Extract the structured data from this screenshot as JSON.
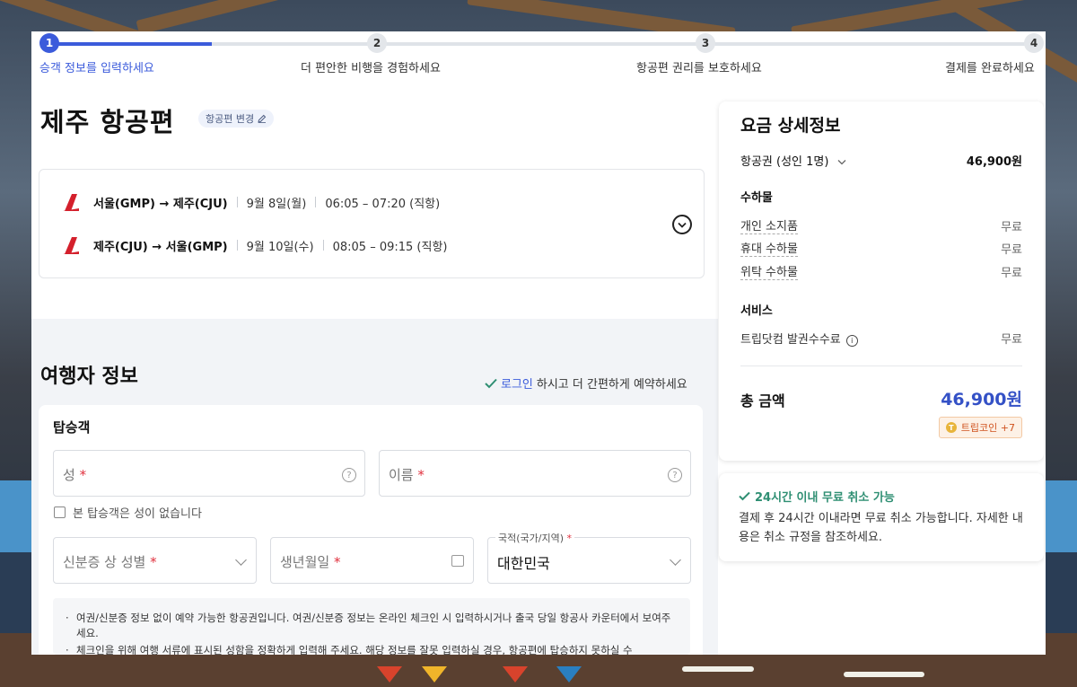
{
  "stepper": {
    "steps": [
      {
        "num": "1",
        "label": "승객 정보를 입력하세요"
      },
      {
        "num": "2",
        "label": "더 편안한 비행을 경험하세요"
      },
      {
        "num": "3",
        "label": "항공편 권리를 보호하세요"
      },
      {
        "num": "4",
        "label": "결제를 완료하세요"
      }
    ],
    "active_step": 1
  },
  "page": {
    "title": "제주 항공편",
    "change_flight_label": "항공편 변경"
  },
  "flights": [
    {
      "route": "서울(GMP) → 제주(CJU)",
      "date": "9월 8일(월)",
      "time": "06:05 – 07:20 (직항)"
    },
    {
      "route": "제주(CJU) → 서울(GMP)",
      "date": "9월 10일(수)",
      "time": "08:05 – 09:15 (직항)"
    }
  ],
  "traveler": {
    "section_title": "여행자 정보",
    "login_link": "로그인",
    "login_hint": "하시고 더 간편하게 예약하세요",
    "passenger_title": "탑승객",
    "surname_placeholder": "성",
    "given_name_placeholder": "이름",
    "required_mark": "*",
    "no_surname_label": "본 탑승객은 성이 없습니다",
    "gender_placeholder": "신분증 상 성별",
    "birthdate_placeholder": "생년월일",
    "nationality_label": "국적(국가/지역)",
    "nationality_value": "대한민국",
    "notice_lines": [
      "여권/신분증 정보 없이 예약 가능한 항공권입니다. 여권/신분증 정보는 온라인 체크인 시 입력하시거나 출국 당일 항공사 카운터에서 보여주세요.",
      "체크인을 위해 여행 서류에 표시된 성함을 정확하게 입력해 주세요. 해당 정보를 잘못 입력하실 경우, 항공편에 탑승하지 못하실 수"
    ]
  },
  "fare": {
    "title": "요금 상세정보",
    "ticket_label": "항공권 (성인 1명)",
    "ticket_price": "46,900원",
    "baggage_title": "수하물",
    "baggage": [
      {
        "label": "개인 소지품",
        "value": "무료"
      },
      {
        "label": "휴대 수하물",
        "value": "무료"
      },
      {
        "label": "위탁 수하물",
        "value": "무료"
      }
    ],
    "service_title": "서비스",
    "service_fee_label": "트립닷컴 발권수수료",
    "service_fee_value": "무료",
    "total_label": "총 금액",
    "total_value": "46,900원",
    "coin_label": "트립코인 +7"
  },
  "cancel": {
    "title": "24시간 이내 무료 취소 가능",
    "description": "결제 후 24시간 이내라면 무료 취소 가능합니다. 자세한 내용은 취소 규정을 참조하세요."
  },
  "colors": {
    "accent": "#3b5bdb",
    "total": "#3451c6",
    "cancel_green": "#2f8f73",
    "required_red": "#e0303d"
  }
}
